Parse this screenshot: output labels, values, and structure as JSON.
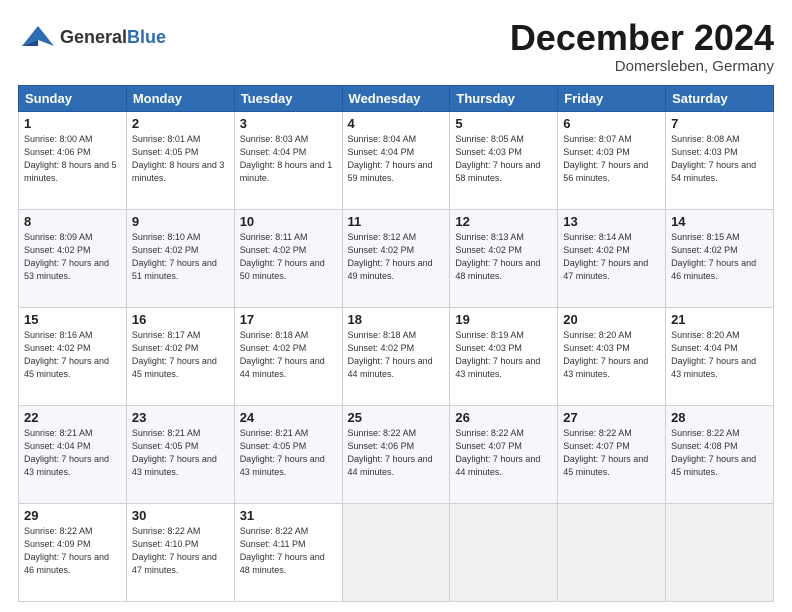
{
  "header": {
    "logo_general": "General",
    "logo_blue": "Blue",
    "month_title": "December 2024",
    "location": "Domersleben, Germany"
  },
  "days_of_week": [
    "Sunday",
    "Monday",
    "Tuesday",
    "Wednesday",
    "Thursday",
    "Friday",
    "Saturday"
  ],
  "weeks": [
    [
      {
        "day": "1",
        "sunrise": "8:00 AM",
        "sunset": "4:06 PM",
        "daylight": "8 hours and 5 minutes."
      },
      {
        "day": "2",
        "sunrise": "8:01 AM",
        "sunset": "4:05 PM",
        "daylight": "8 hours and 3 minutes."
      },
      {
        "day": "3",
        "sunrise": "8:03 AM",
        "sunset": "4:04 PM",
        "daylight": "8 hours and 1 minute."
      },
      {
        "day": "4",
        "sunrise": "8:04 AM",
        "sunset": "4:04 PM",
        "daylight": "7 hours and 59 minutes."
      },
      {
        "day": "5",
        "sunrise": "8:05 AM",
        "sunset": "4:03 PM",
        "daylight": "7 hours and 58 minutes."
      },
      {
        "day": "6",
        "sunrise": "8:07 AM",
        "sunset": "4:03 PM",
        "daylight": "7 hours and 56 minutes."
      },
      {
        "day": "7",
        "sunrise": "8:08 AM",
        "sunset": "4:03 PM",
        "daylight": "7 hours and 54 minutes."
      }
    ],
    [
      {
        "day": "8",
        "sunrise": "8:09 AM",
        "sunset": "4:02 PM",
        "daylight": "7 hours and 53 minutes."
      },
      {
        "day": "9",
        "sunrise": "8:10 AM",
        "sunset": "4:02 PM",
        "daylight": "7 hours and 51 minutes."
      },
      {
        "day": "10",
        "sunrise": "8:11 AM",
        "sunset": "4:02 PM",
        "daylight": "7 hours and 50 minutes."
      },
      {
        "day": "11",
        "sunrise": "8:12 AM",
        "sunset": "4:02 PM",
        "daylight": "7 hours and 49 minutes."
      },
      {
        "day": "12",
        "sunrise": "8:13 AM",
        "sunset": "4:02 PM",
        "daylight": "7 hours and 48 minutes."
      },
      {
        "day": "13",
        "sunrise": "8:14 AM",
        "sunset": "4:02 PM",
        "daylight": "7 hours and 47 minutes."
      },
      {
        "day": "14",
        "sunrise": "8:15 AM",
        "sunset": "4:02 PM",
        "daylight": "7 hours and 46 minutes."
      }
    ],
    [
      {
        "day": "15",
        "sunrise": "8:16 AM",
        "sunset": "4:02 PM",
        "daylight": "7 hours and 45 minutes."
      },
      {
        "day": "16",
        "sunrise": "8:17 AM",
        "sunset": "4:02 PM",
        "daylight": "7 hours and 45 minutes."
      },
      {
        "day": "17",
        "sunrise": "8:18 AM",
        "sunset": "4:02 PM",
        "daylight": "7 hours and 44 minutes."
      },
      {
        "day": "18",
        "sunrise": "8:18 AM",
        "sunset": "4:02 PM",
        "daylight": "7 hours and 44 minutes."
      },
      {
        "day": "19",
        "sunrise": "8:19 AM",
        "sunset": "4:03 PM",
        "daylight": "7 hours and 43 minutes."
      },
      {
        "day": "20",
        "sunrise": "8:20 AM",
        "sunset": "4:03 PM",
        "daylight": "7 hours and 43 minutes."
      },
      {
        "day": "21",
        "sunrise": "8:20 AM",
        "sunset": "4:04 PM",
        "daylight": "7 hours and 43 minutes."
      }
    ],
    [
      {
        "day": "22",
        "sunrise": "8:21 AM",
        "sunset": "4:04 PM",
        "daylight": "7 hours and 43 minutes."
      },
      {
        "day": "23",
        "sunrise": "8:21 AM",
        "sunset": "4:05 PM",
        "daylight": "7 hours and 43 minutes."
      },
      {
        "day": "24",
        "sunrise": "8:21 AM",
        "sunset": "4:05 PM",
        "daylight": "7 hours and 43 minutes."
      },
      {
        "day": "25",
        "sunrise": "8:22 AM",
        "sunset": "4:06 PM",
        "daylight": "7 hours and 44 minutes."
      },
      {
        "day": "26",
        "sunrise": "8:22 AM",
        "sunset": "4:07 PM",
        "daylight": "7 hours and 44 minutes."
      },
      {
        "day": "27",
        "sunrise": "8:22 AM",
        "sunset": "4:07 PM",
        "daylight": "7 hours and 45 minutes."
      },
      {
        "day": "28",
        "sunrise": "8:22 AM",
        "sunset": "4:08 PM",
        "daylight": "7 hours and 45 minutes."
      }
    ],
    [
      {
        "day": "29",
        "sunrise": "8:22 AM",
        "sunset": "4:09 PM",
        "daylight": "7 hours and 46 minutes."
      },
      {
        "day": "30",
        "sunrise": "8:22 AM",
        "sunset": "4:10 PM",
        "daylight": "7 hours and 47 minutes."
      },
      {
        "day": "31",
        "sunrise": "8:22 AM",
        "sunset": "4:11 PM",
        "daylight": "7 hours and 48 minutes."
      },
      null,
      null,
      null,
      null
    ]
  ]
}
